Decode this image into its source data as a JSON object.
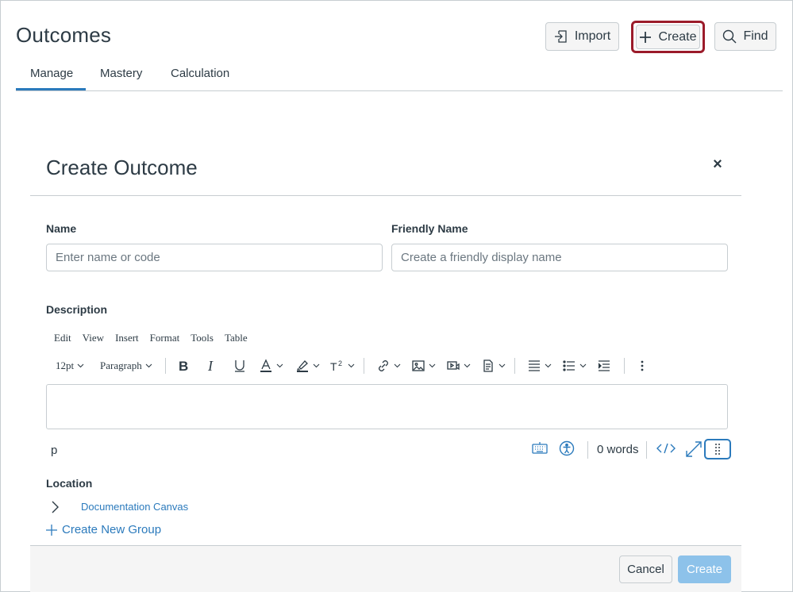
{
  "header": {
    "title": "Outcomes",
    "buttons": {
      "import": "Import",
      "create": "Create",
      "find": "Find"
    }
  },
  "tabs": [
    {
      "label": "Manage",
      "active": true
    },
    {
      "label": "Mastery",
      "active": false
    },
    {
      "label": "Calculation",
      "active": false
    }
  ],
  "modal": {
    "title": "Create Outcome",
    "close_icon": "close-icon",
    "fields": {
      "name": {
        "label": "Name",
        "placeholder": "Enter name or code",
        "value": ""
      },
      "friendly_name": {
        "label": "Friendly Name",
        "placeholder": "Create a friendly display name",
        "value": ""
      },
      "description": {
        "label": "Description"
      }
    },
    "editor": {
      "menu": [
        "Edit",
        "View",
        "Insert",
        "Format",
        "Tools",
        "Table"
      ],
      "font_size": "12pt",
      "block_format": "Paragraph",
      "toolbar_icons": [
        "bold-icon",
        "italic-icon",
        "underline-icon",
        "text-color-icon",
        "highlight-icon",
        "superscript-icon",
        "link-icon",
        "image-icon",
        "media-icon",
        "document-icon",
        "align-icon",
        "list-icon",
        "indent-icon",
        "more-icon"
      ],
      "status": {
        "path": "p",
        "word_count": "0 words",
        "icons": [
          "keyboard-icon",
          "accessibility-icon",
          "html-editor-icon",
          "fullscreen-icon",
          "resize-handle-icon"
        ]
      }
    },
    "location": {
      "label": "Location",
      "group": "Documentation Canvas",
      "new_group": "Create New Group"
    },
    "footer": {
      "cancel": "Cancel",
      "create": "Create"
    }
  },
  "colors": {
    "accent": "#2b7abc",
    "highlight_ring": "#9b1b2a",
    "create_disabled": "#8dc2ea",
    "text": "#2d3b45",
    "border": "#c7cdd1"
  }
}
